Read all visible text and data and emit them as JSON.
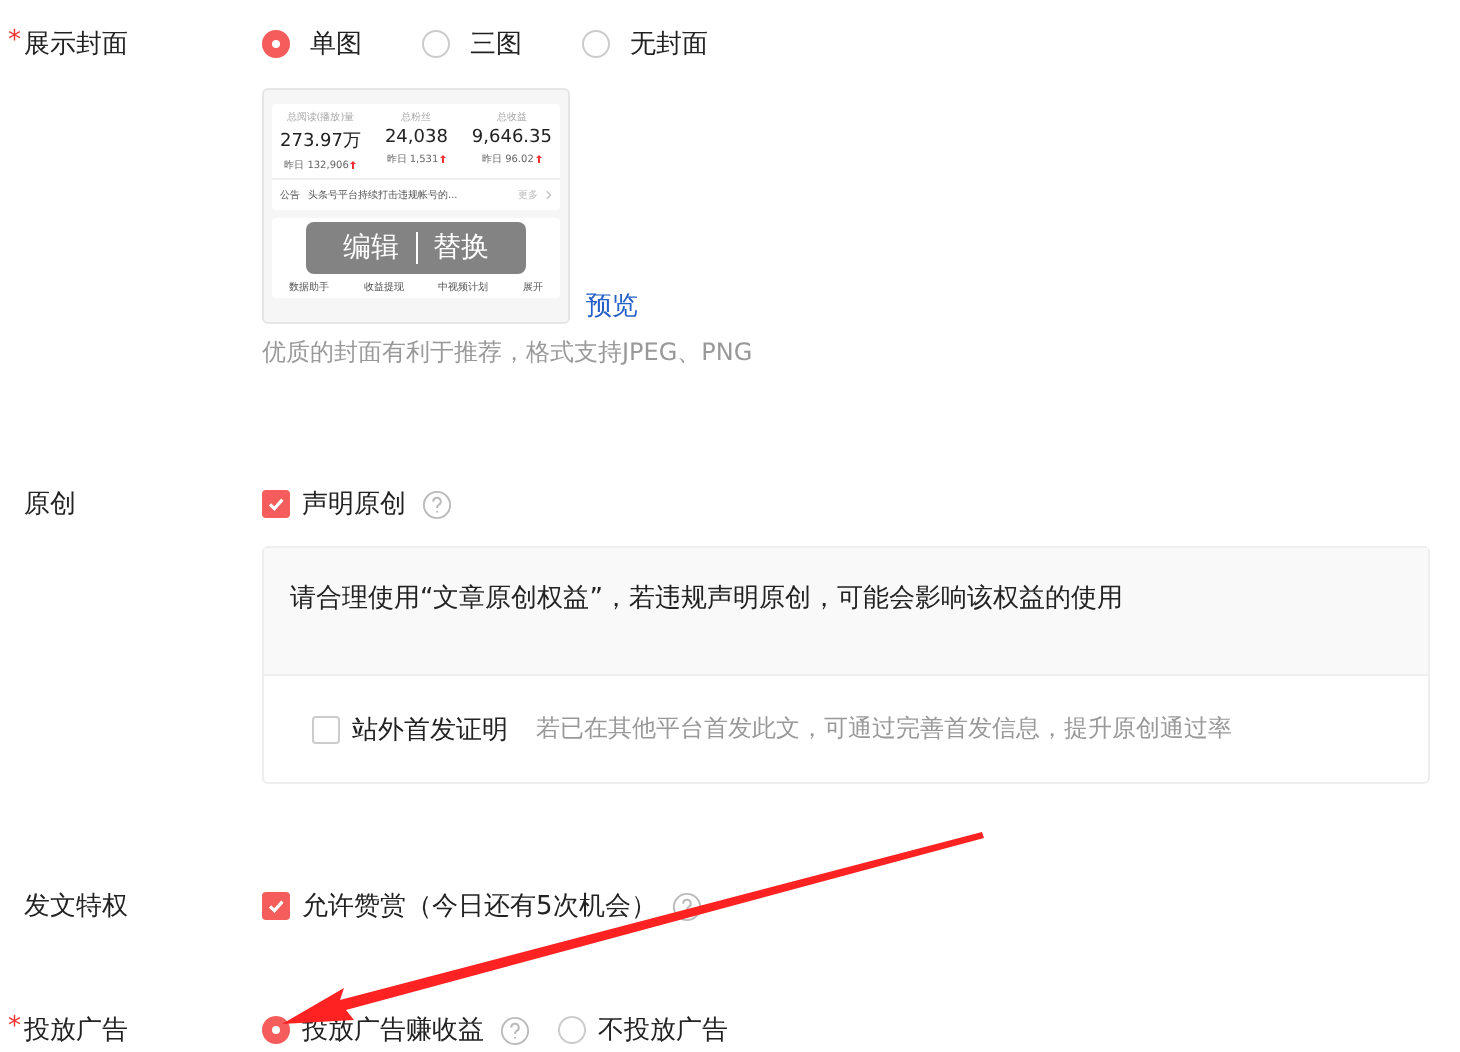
{
  "cover": {
    "asterisk": "*",
    "label": "展示封面",
    "options": [
      {
        "label": "单图",
        "selected": true
      },
      {
        "label": "三图",
        "selected": false
      },
      {
        "label": "无封面",
        "selected": false
      }
    ],
    "thumbnail": {
      "stats": [
        {
          "title": "总阅读(播放)量",
          "value": "273.97万",
          "delta": "昨日 132,906"
        },
        {
          "title": "总粉丝",
          "value": "24,038",
          "delta": "昨日 1,531"
        },
        {
          "title": "总收益",
          "value": "9,646.35",
          "delta": "昨日 96.02"
        }
      ],
      "notice": {
        "tag": "公告",
        "text": "头条号平台持续打击违规帐号的...",
        "more": "更多"
      },
      "shortcuts": [
        "数据助手",
        "收益提现",
        "中视频计划",
        "展开"
      ]
    },
    "edit_button": "编辑",
    "replace_button": "替换",
    "preview_link": "预览",
    "hint": "优质的封面有利于推荐，格式支持JPEG、PNG"
  },
  "original": {
    "label": "原创",
    "checkbox": {
      "label": "声明原创",
      "checked": true,
      "help": true
    },
    "notice": "请合理使用“文章原创权益”，若违规声明原创，可能会影响该权益的使用",
    "first_publish": {
      "label": "站外首发证明",
      "checked": false,
      "hint": "若已在其他平台首发此文，可通过完善首发信息，提升原创通过率"
    }
  },
  "privilege": {
    "label": "发文特权",
    "checkbox": {
      "label": "允许赞赏（今日还有5次机会）",
      "checked": true,
      "help": true
    }
  },
  "ads": {
    "asterisk": "*",
    "label": "投放广告",
    "options": [
      {
        "label": "投放广告赚收益",
        "selected": true,
        "help": true
      },
      {
        "label": "不投放广告",
        "selected": false,
        "help": false
      }
    ]
  }
}
